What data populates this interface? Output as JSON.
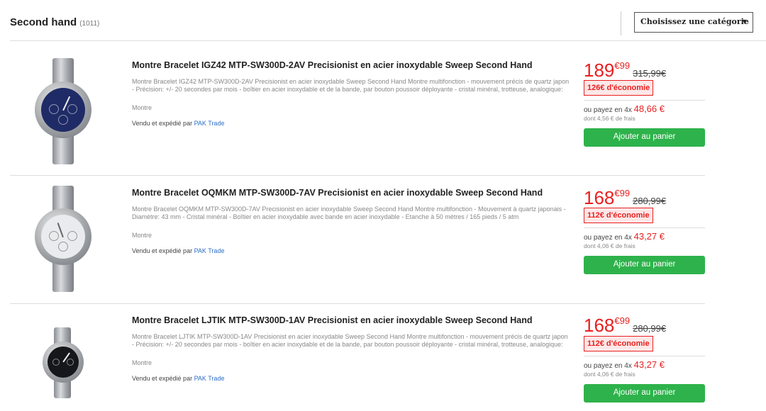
{
  "header": {
    "title": "Second hand",
    "count": "(1011)",
    "category_select": {
      "selected": "Choisissez une catégorie",
      "arrow": "▼"
    }
  },
  "products": [
    {
      "title": "Montre Bracelet IGZ42 MTP-SW300D-2AV Precisionist en acier inoxydable Sweep Second Hand",
      "description": "Montre Bracelet IGZ42 MTP-SW300D-2AV Precisionist en acier inoxydable Sweep Second Hand Montre multifonction - mouvement précis de quartz japon - Précision: +/- 20 secondes par mois - boîtier en acier inoxydable et de la bande, par bouton poussoir déployante - cristal minéral, trotteuse, analogique:",
      "category": "Montre",
      "seller_prefix": "Vendu et expédié par",
      "seller": "PAK Trade",
      "price_main": "189",
      "price_cents": "€99",
      "price_old": "315,99€",
      "saving": "126€ d'économie",
      "installment_prefix": "ou payez en 4x",
      "installment_amount": "48,66 €",
      "fees": "dont 4,56 € de frais",
      "cart_label": "Ajouter au panier",
      "dial_color": "#1f2b66"
    },
    {
      "title": "Montre Bracelet OQMKM MTP-SW300D-7AV Precisionist en acier inoxydable Sweep Second Hand",
      "description": "Montre Bracelet OQMKM MTP-SW300D-7AV Precisionist en acier inoxydable Sweep Second Hand Montre multifonction - Mouvement à quartz japonais - Diamètre: 43 mm - Cristal minéral - Boîtier en acier inoxydable avec bande en acier inoxydable - Etanche à 50 mètres / 165 pieds / 5 atm",
      "category": "Montre",
      "seller_prefix": "Vendu et expédié par",
      "seller": "PAK Trade",
      "price_main": "168",
      "price_cents": "€99",
      "price_old": "280,99€",
      "saving": "112€ d'économie",
      "installment_prefix": "ou payez en 4x",
      "installment_amount": "43,27 €",
      "fees": "dont 4,06 € de frais",
      "cart_label": "Ajouter au panier",
      "dial_color": "#e9ebee"
    },
    {
      "title": "Montre Bracelet LJTIK MTP-SW300D-1AV Precisionist en acier inoxydable Sweep Second Hand",
      "description": "Montre Bracelet LJTIK MTP-SW300D-1AV Precisionist en acier inoxydable Sweep Second Hand Montre multifonction - mouvement précis de quartz japon - Précision: +/- 20 secondes par mois - boîtier en acier inoxydable et de la bande, par bouton poussoir déployante - cristal minéral, trotteuse, analogique:",
      "category": "Montre",
      "seller_prefix": "Vendu et expédié par",
      "seller": "PAK Trade",
      "price_main": "168",
      "price_cents": "€99",
      "price_old": "280,99€",
      "saving": "112€ d'économie",
      "installment_prefix": "ou payez en 4x",
      "installment_amount": "43,27 €",
      "fees": "dont 4,06 € de frais",
      "cart_label": "Ajouter au panier",
      "dial_color": "#15171a"
    }
  ]
}
